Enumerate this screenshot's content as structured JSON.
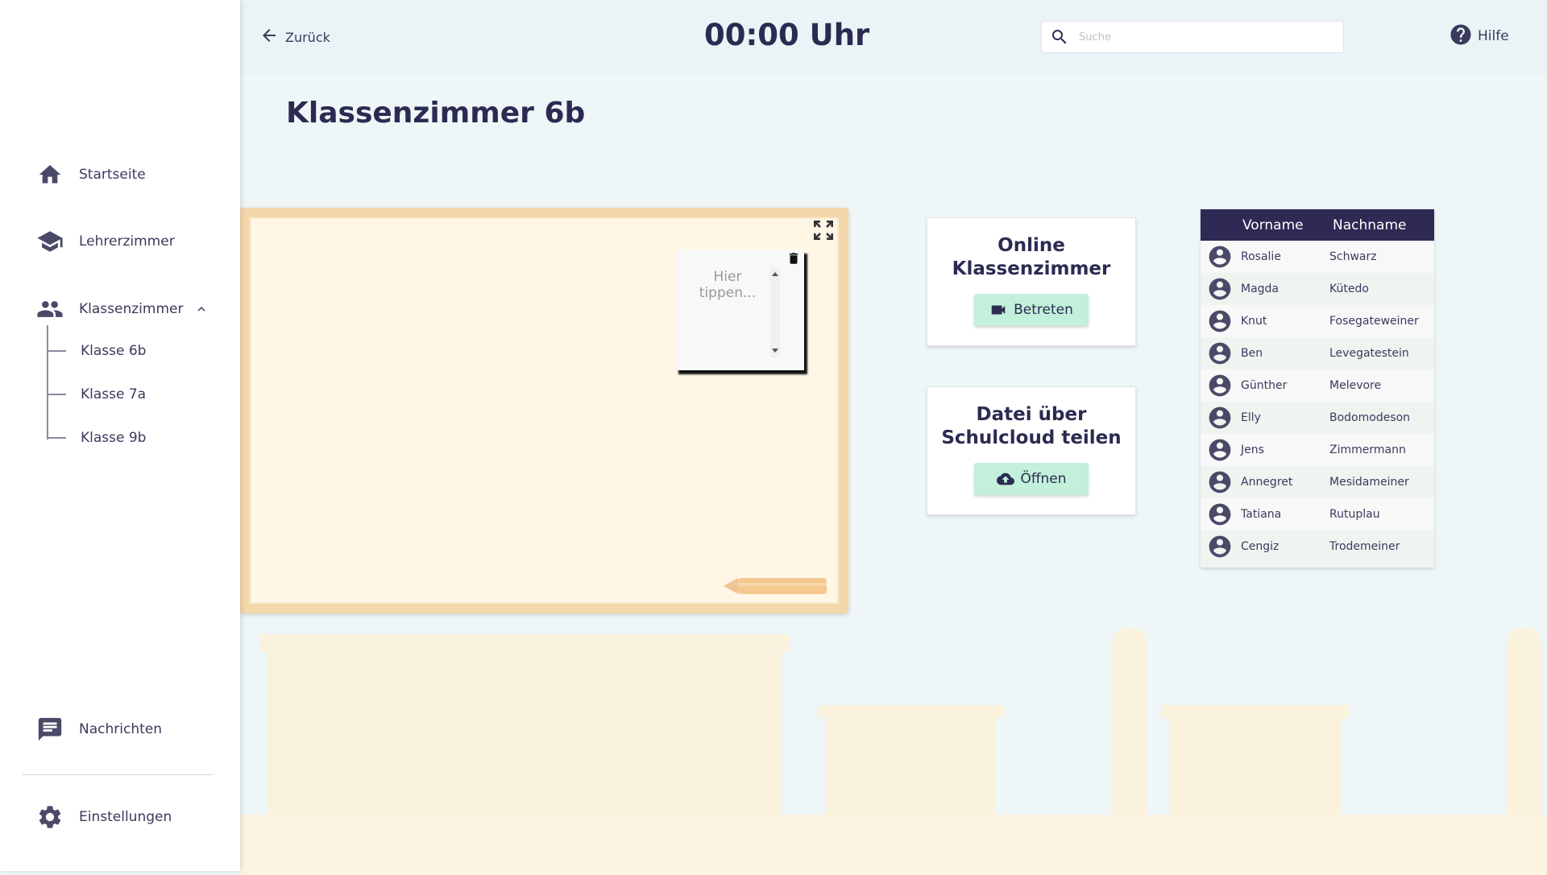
{
  "sidebar": {
    "items": [
      {
        "label": "Startseite",
        "icon": "home-icon"
      },
      {
        "label": "Lehrerzimmer",
        "icon": "graduation-cap-icon"
      },
      {
        "label": "Klassenzimmer",
        "icon": "group-icon"
      }
    ],
    "sub_items": [
      "Klasse 6b",
      "Klasse 7a",
      "Klasse 9b"
    ],
    "bottom_items": [
      {
        "label": "Nachrichten",
        "icon": "message-icon"
      },
      {
        "label": "Einstellungen",
        "icon": "gear-icon"
      }
    ]
  },
  "header": {
    "back_label": "Zurück",
    "clock": "00:00 Uhr",
    "search_placeholder": "Suche",
    "help_label": "Hilfe"
  },
  "page_title": "Klassenzimmer 6b",
  "note": {
    "placeholder": "Hier tippen..."
  },
  "cards": {
    "online": {
      "title": "Online Klassenzimmer",
      "button": "Betreten"
    },
    "share": {
      "title": "Datei über Schulcloud teilen",
      "button": "Öffnen"
    }
  },
  "roster": {
    "headers": [
      "Vorname",
      "Nachname"
    ],
    "rows": [
      [
        "Rosalie",
        "Schwarz"
      ],
      [
        "Magda",
        "Kütedo"
      ],
      [
        "Knut",
        "Fosegateweiner"
      ],
      [
        "Ben",
        "Levegatestein"
      ],
      [
        "Günther",
        "Melevore"
      ],
      [
        "Elly",
        "Bodomodeson"
      ],
      [
        "Jens",
        "Zimmermann"
      ],
      [
        "Annegret",
        "Mesidameiner"
      ],
      [
        "Tatiana",
        "Rutuplau"
      ],
      [
        "Cengiz",
        "Trodemeiner"
      ]
    ]
  },
  "colors": {
    "primary": "#2e2a54",
    "accent_button": "#c2f0da",
    "board_frame": "#f5d7ac",
    "board_surface": "#fff6e6",
    "background": "#eef6f8"
  }
}
